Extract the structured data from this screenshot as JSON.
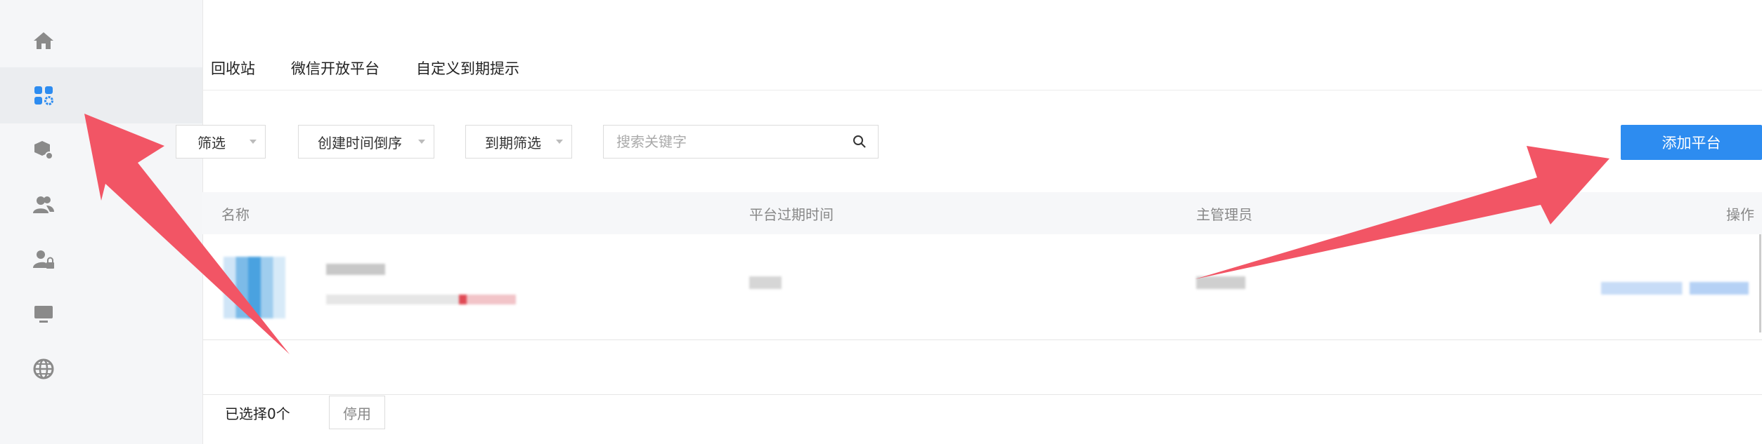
{
  "sidebar": {
    "items": [
      {
        "icon": "home-icon"
      },
      {
        "icon": "apps-settings-icon",
        "active": true
      },
      {
        "icon": "box-settings-icon"
      },
      {
        "icon": "users-icon"
      },
      {
        "icon": "user-lock-icon"
      },
      {
        "icon": "monitor-icon"
      },
      {
        "icon": "globe-icon"
      }
    ]
  },
  "tabs": [
    "回收站",
    "微信开放平台",
    "自定义到期提示"
  ],
  "toolbar": {
    "filter1_label": "筛选",
    "sort_label": "创建时间倒序",
    "expire_filter_label": "到期筛选",
    "search_placeholder": "搜索关键字",
    "add_button": "添加平台"
  },
  "table": {
    "columns": {
      "name": "名称",
      "expire_time": "平台过期时间",
      "admin": "主管理员",
      "actions": "操作"
    }
  },
  "footer": {
    "selected_text": "已选择0个",
    "disable_button": "停用"
  },
  "colors": {
    "primary": "#2d8cf0",
    "arrow": "#f25565",
    "sidebar_bg": "#f5f6f8",
    "active_icon": "#2d8cf0"
  }
}
